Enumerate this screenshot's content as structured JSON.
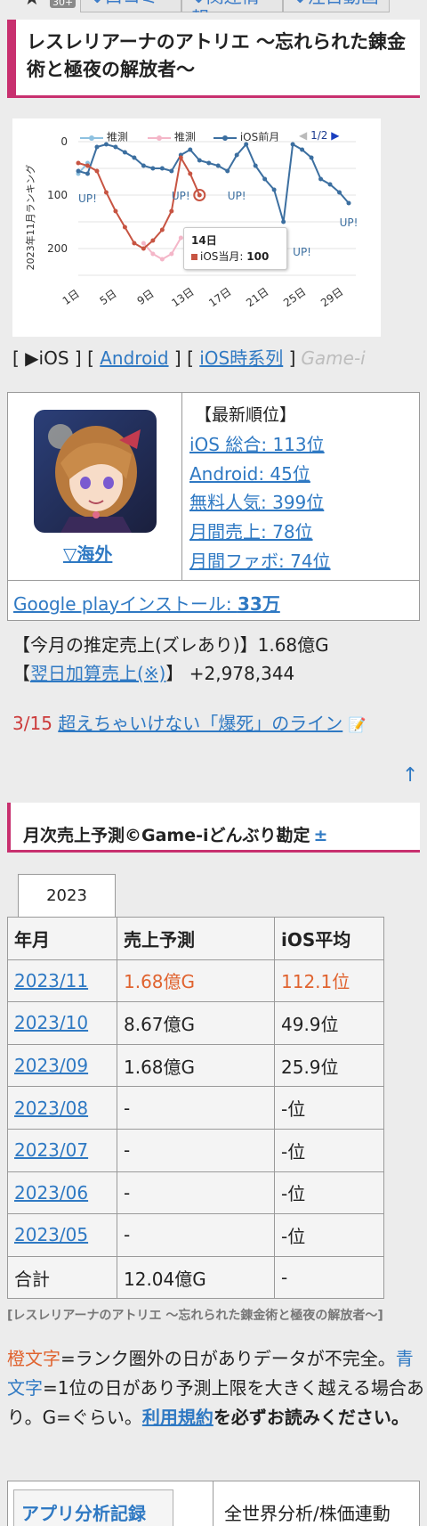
{
  "nav": {
    "badge": "30+",
    "tabs": [
      "↓口コミ",
      "↓関連情報",
      "↓注目動画"
    ]
  },
  "title": "レスレリアーナのアトリエ 〜忘れられた錬金術と極夜の解放者〜",
  "chart_data": {
    "type": "line",
    "ylabel": "2023年11月ランキング",
    "legend": [
      "推測",
      "推測",
      "iOS前月"
    ],
    "page_indicator": "1/2",
    "x_ticks": [
      "1日",
      "5日",
      "9日",
      "13日",
      "17日",
      "21日",
      "25日",
      "29日"
    ],
    "y_ticks": [
      0,
      100,
      200
    ],
    "ylim": [
      0,
      250
    ],
    "y_inverted": true,
    "annotations": [
      "UP!",
      "UP!",
      "UP!",
      "UP!",
      "UP!"
    ],
    "series": [
      {
        "name": "推測",
        "color": "#8ec1e0",
        "x": [
          1,
          2
        ],
        "values": [
          60,
          40
        ]
      },
      {
        "name": "推測",
        "color": "#f4b6c8",
        "x": [
          8,
          9,
          10,
          11,
          12
        ],
        "values": [
          190,
          210,
          220,
          210,
          180
        ]
      },
      {
        "name": "iOS前月",
        "color": "#3c6fa0",
        "x": [
          1,
          2,
          3,
          4,
          5,
          6,
          7,
          8,
          9,
          10,
          11,
          12,
          13,
          14,
          15,
          16,
          17,
          18,
          19,
          20,
          21,
          22,
          23,
          24,
          25,
          26,
          27,
          28,
          29,
          30
        ],
        "values": [
          55,
          60,
          10,
          5,
          10,
          20,
          30,
          45,
          50,
          50,
          55,
          25,
          15,
          35,
          40,
          45,
          55,
          25,
          5,
          45,
          70,
          90,
          150,
          5,
          15,
          30,
          70,
          80,
          95,
          115
        ]
      },
      {
        "name": "iOS当月",
        "color": "#c75442",
        "x": [
          1,
          2,
          3,
          4,
          5,
          6,
          7,
          8,
          9,
          10,
          11,
          12,
          13,
          14
        ],
        "values": [
          40,
          45,
          55,
          95,
          130,
          160,
          190,
          200,
          185,
          165,
          130,
          30,
          60,
          100
        ]
      }
    ],
    "tooltip": {
      "day": "14日",
      "label": "iOS当月:",
      "value": "100"
    }
  },
  "source_line": {
    "ios": "▶iOS",
    "android": "Android",
    "series": "iOS時系列",
    "brand": "Game-i"
  },
  "info": {
    "overseas": "▽海外",
    "rank_header": "【最新順位】",
    "ranks": [
      "iOS 総合: 113位",
      "Android: 45位",
      "無料人気: 399位",
      "月間売上: 78位",
      "月間ファボ: 74位"
    ],
    "install_label": "Google playインストール: ",
    "install_value": "33万"
  },
  "sales": {
    "estimate_label": "【今月の推定売上(ズレあり)】",
    "estimate_value": "1.68億G",
    "next_label": "翌日加算売上(※)",
    "next_value": "】 +2,978,344"
  },
  "news": {
    "date": "3/15",
    "link": "超えちゃいけない「爆死」のライン"
  },
  "section_title": "月次売上予測©Game-iどんぶり勘定",
  "year_tab": "2023",
  "table": {
    "headers": [
      "年月",
      "売上予測",
      "iOS平均"
    ],
    "rows": [
      [
        "2023/11",
        "1.68億G",
        "112.1位"
      ],
      [
        "2023/10",
        "8.67億G",
        "49.9位"
      ],
      [
        "2023/09",
        "1.68億G",
        "25.9位"
      ],
      [
        "2023/08",
        "-",
        "-位"
      ],
      [
        "2023/07",
        "-",
        "-位"
      ],
      [
        "2023/06",
        "-",
        "-位"
      ],
      [
        "2023/05",
        "-",
        "-位"
      ]
    ],
    "total": [
      "合計",
      "12.04億G",
      "-"
    ]
  },
  "footnote_title": "[レスレリアーナのアトリエ 〜忘れられた錬金術と極夜の解放者〜]",
  "footnote": {
    "orange_word": "橙文字",
    "orange_text": "=ランク圏外の日がありデータが不完全。",
    "blue_word": "青文字",
    "blue_text": "=1位の日があり予測上限を大きく越える場合あり。G=ぐらい。",
    "terms": "利用規約",
    "terms_tail": "を必ずお読みください。"
  },
  "bottom_tabs": [
    "アプリ分析記録",
    "全世界分析/株価連動"
  ],
  "colors": {
    "accent": "#c8306f",
    "link": "#2f79c3",
    "warning": "#e0632f"
  }
}
